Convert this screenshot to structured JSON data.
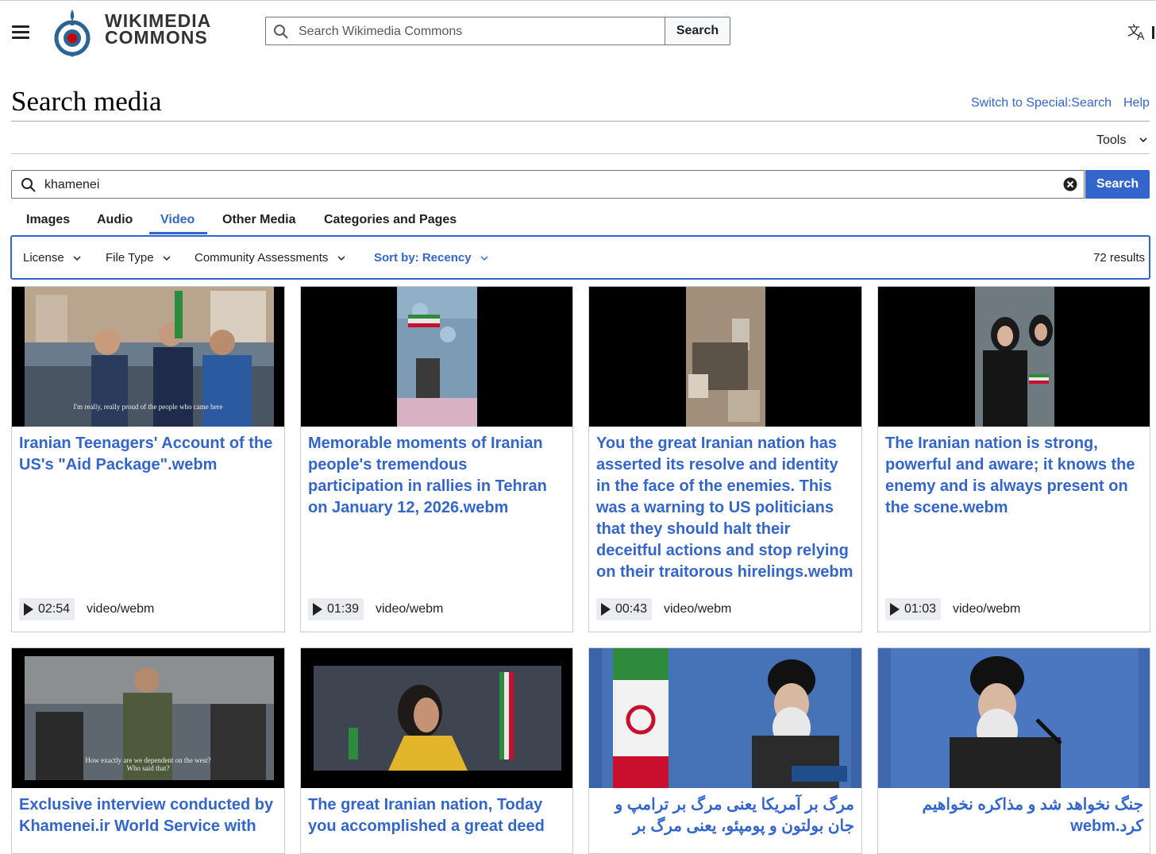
{
  "header": {
    "wordmark_line1": "WIKIMEDIA",
    "wordmark_line2": "COMMONS",
    "search_placeholder": "Search Wikimedia Commons",
    "search_button": "Search",
    "menu_icon": "hamburger-menu-icon",
    "language_icon": "language-icon"
  },
  "page": {
    "title": "Search media",
    "switch_link": "Switch to Special:Search",
    "help_link": "Help",
    "tools_label": "Tools"
  },
  "search": {
    "query": "khamenei",
    "button": "Search"
  },
  "tabs": [
    {
      "label": "Images",
      "active": false
    },
    {
      "label": "Audio",
      "active": false
    },
    {
      "label": "Video",
      "active": true
    },
    {
      "label": "Other Media",
      "active": false
    },
    {
      "label": "Categories and Pages",
      "active": false
    }
  ],
  "filters": {
    "license": "License",
    "file_type": "File Type",
    "community": "Community Assessments",
    "sort": "Sort by: Recency",
    "results": "72 results"
  },
  "cards": [
    {
      "title": "Iranian Teenagers' Account of the US's \"Aid Package\".webm",
      "duration": "02:54",
      "mime": "video/webm",
      "caption": "I'm really, really proud of the people who came here"
    },
    {
      "title": "Memorable moments of Iranian people's tremendous participation in rallies in Tehran on January 12, 2026.webm",
      "duration": "01:39",
      "mime": "video/webm"
    },
    {
      "title": "You the great Iranian nation has asserted its resolve and identity in the face of the enemies. This was a warning to US politicians that they should halt their deceitful actions and stop relying on their traitorous hirelings.webm",
      "duration": "00:43",
      "mime": "video/webm"
    },
    {
      "title": "The Iranian nation is strong, powerful and aware; it knows the enemy and is always present on the scene.webm",
      "duration": "01:03",
      "mime": "video/webm"
    },
    {
      "title": "Exclusive interview conducted by Khamenei.ir World Service with",
      "caption1": "How exactly are we dependent on the west?",
      "caption2": "Who said that?"
    },
    {
      "title": "The great Iranian nation, Today you accomplished a great deed"
    },
    {
      "title": "مرگ بر آمریکا یعنی مرگ بر ترامپ و جان بولتون و پومپئو، یعنی مرگ بر"
    },
    {
      "title": "جنگ نخواهد شد و مذاکره نخواهیم کرد.webm"
    }
  ],
  "colors": {
    "link": "#3366cc",
    "button_primary": "#3366cc",
    "text": "#202122",
    "border": "#c8ccd1"
  }
}
